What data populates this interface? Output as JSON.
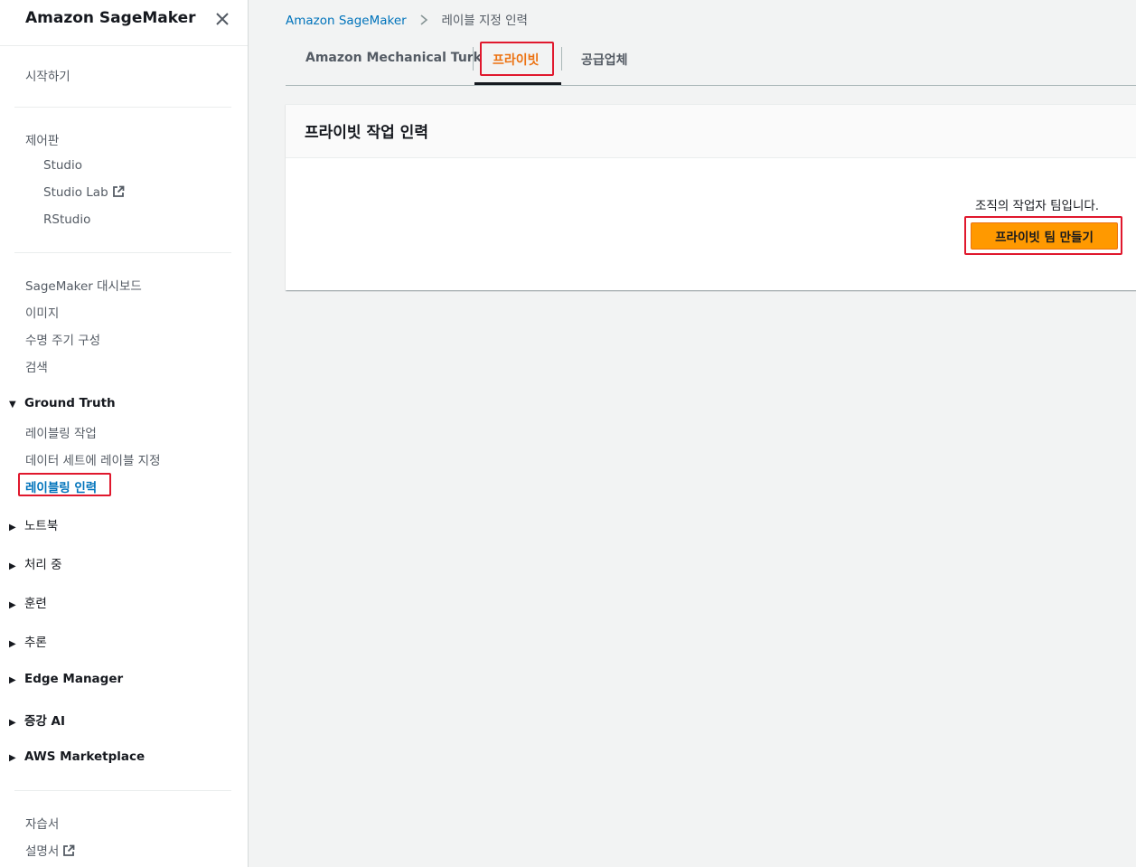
{
  "sidebar": {
    "title": "Amazon SageMaker",
    "getting_started": "시작하기",
    "control_panel": "제어판",
    "control_items": [
      "Studio",
      "Studio Lab",
      "RStudio"
    ],
    "general_items": [
      "SageMaker 대시보드",
      "이미지",
      "수명 주기 구성",
      "검색"
    ],
    "ground_truth": {
      "label": "Ground Truth",
      "items": [
        "레이블링 작업",
        "데이터 세트에 레이블 지정",
        "레이블링 인력"
      ]
    },
    "sections": [
      "노트북",
      "처리 중",
      "훈련",
      "추론",
      "Edge Manager",
      "증강 AI",
      "AWS Marketplace"
    ],
    "footer_items": [
      "자습서",
      "설명서"
    ]
  },
  "breadcrumb": {
    "root": "Amazon SageMaker",
    "current": "레이블 지정 인력"
  },
  "tabs": [
    "Amazon Mechanical Turk",
    "프라이빗",
    "공급업체"
  ],
  "active_tab": "프라이빗",
  "panel": {
    "title": "프라이빗 작업 인력",
    "description": "조직의 작업자 팀입니다.",
    "create_button": "프라이빗 팀 만들기"
  },
  "colors": {
    "accent": "#ec7211",
    "button": "#ff9900",
    "link": "#0073bb",
    "highlight": "#e0182d"
  }
}
